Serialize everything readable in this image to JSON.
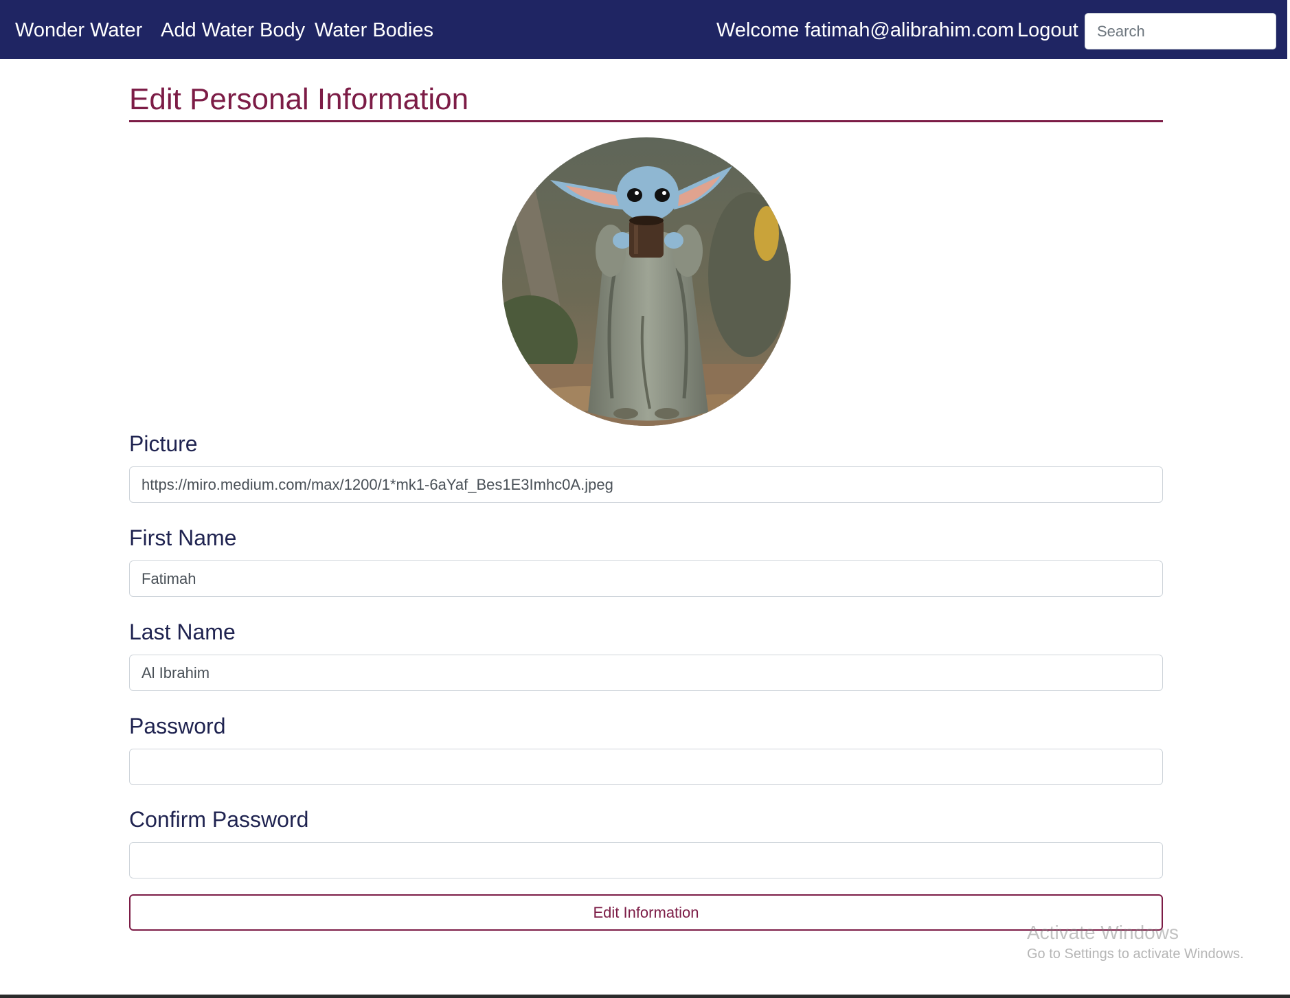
{
  "navbar": {
    "brand": "Wonder Water",
    "links": [
      "Add Water Body",
      "Water Bodies"
    ],
    "welcome": "Welcome fatimah@alibrahim.com",
    "logout": "Logout",
    "search_placeholder": "Search",
    "background_color": "#1f2563"
  },
  "page": {
    "title": "Edit Personal Information",
    "accent_color": "#7c1c46"
  },
  "avatar": {
    "icon": "profile-picture-baby-yoda"
  },
  "form": {
    "picture": {
      "label": "Picture",
      "value": "https://miro.medium.com/max/1200/1*mk1-6aYaf_Bes1E3Imhc0A.jpeg"
    },
    "first_name": {
      "label": "First Name",
      "value": "Fatimah"
    },
    "last_name": {
      "label": "Last Name",
      "value": "Al Ibrahim"
    },
    "password": {
      "label": "Password",
      "value": ""
    },
    "confirm_password": {
      "label": "Confirm Password",
      "value": ""
    },
    "submit_label": "Edit Information"
  },
  "watermark": {
    "title": "Activate Windows",
    "subtitle": "Go to Settings to activate Windows."
  }
}
